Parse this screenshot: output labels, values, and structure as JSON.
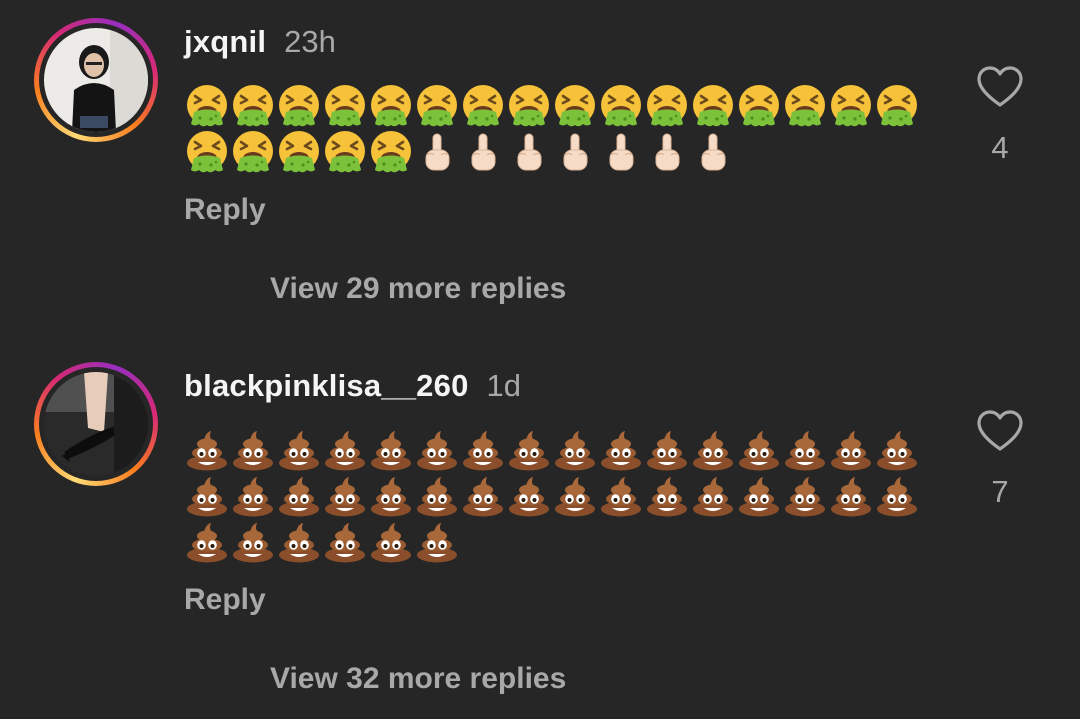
{
  "comments": [
    {
      "username": "jxqnil",
      "time": "23h",
      "emoji_rows": [
        [
          "vomit",
          "vomit",
          "vomit",
          "vomit",
          "vomit",
          "vomit",
          "vomit",
          "vomit",
          "vomit",
          "vomit",
          "vomit",
          "vomit",
          "vomit",
          "vomit",
          "vomit",
          "vomit"
        ],
        [
          "vomit",
          "vomit",
          "vomit",
          "vomit",
          "vomit",
          "finger",
          "finger",
          "finger",
          "finger",
          "finger",
          "finger",
          "finger"
        ]
      ],
      "reply_label": "Reply",
      "like_count": "4",
      "like_icon": "heart-outline-icon",
      "view_replies": "View 29 more replies"
    },
    {
      "username": "blackpinklisa__260",
      "time": "1d",
      "emoji_rows": [
        [
          "poop",
          "poop",
          "poop",
          "poop",
          "poop",
          "poop",
          "poop",
          "poop",
          "poop",
          "poop",
          "poop",
          "poop",
          "poop",
          "poop",
          "poop",
          "poop"
        ],
        [
          "poop",
          "poop",
          "poop",
          "poop",
          "poop",
          "poop",
          "poop",
          "poop",
          "poop",
          "poop",
          "poop",
          "poop",
          "poop",
          "poop",
          "poop",
          "poop"
        ],
        [
          "poop",
          "poop",
          "poop",
          "poop",
          "poop",
          "poop"
        ]
      ],
      "reply_label": "Reply",
      "like_count": "7",
      "like_icon": "heart-outline-icon",
      "view_replies": "View 32 more replies"
    }
  ],
  "colors": {
    "background": "#262626",
    "primary_text": "#f5f5f5",
    "secondary_text": "#a8a8a8",
    "story_ring": [
      "#feda75",
      "#fa7e1e",
      "#d62976",
      "#962fbf"
    ]
  }
}
